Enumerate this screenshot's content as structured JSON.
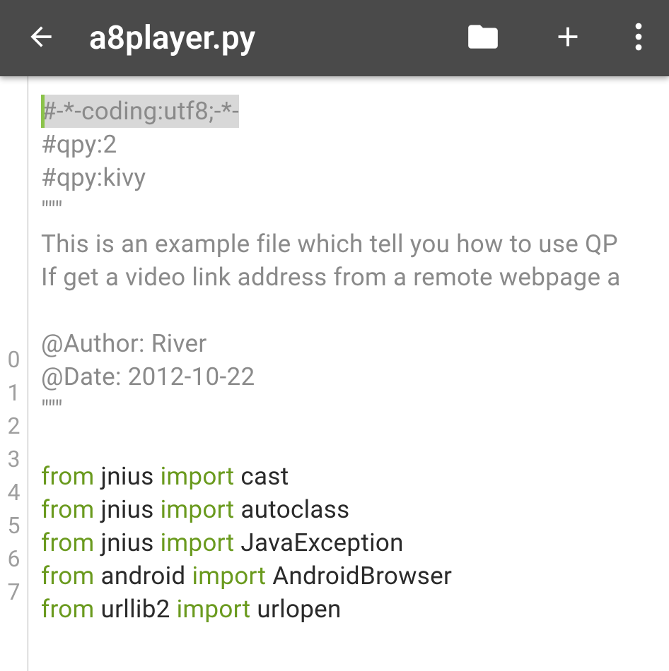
{
  "header": {
    "title": "a8player.py"
  },
  "gutter": {
    "visible_numbers": [
      "0",
      "1",
      "2",
      "3",
      "4",
      "5",
      "6",
      "7"
    ]
  },
  "code": {
    "lines": [
      {
        "type": "coding",
        "text": "#-*-coding:utf8;-*-"
      },
      {
        "type": "comment",
        "text": "#qpy:2"
      },
      {
        "type": "comment",
        "text": "#qpy:kivy"
      },
      {
        "type": "comment",
        "text": "\"\"\""
      },
      {
        "type": "comment",
        "text": "This is an example file which tell you how to use QP"
      },
      {
        "type": "comment",
        "text": "If get a video link address from a remote webpage a"
      },
      {
        "type": "comment",
        "text": ""
      },
      {
        "type": "comment",
        "text": "@Author: River"
      },
      {
        "type": "comment",
        "text": "@Date: 2012-10-22"
      },
      {
        "type": "comment",
        "text": "\"\"\""
      },
      {
        "type": "comment",
        "text": ""
      },
      {
        "type": "import",
        "kw1": "from",
        "mod": "jnius",
        "kw2": "import",
        "name": "cast"
      },
      {
        "type": "import",
        "kw1": "from",
        "mod": "jnius",
        "kw2": "import",
        "name": "autoclass"
      },
      {
        "type": "import",
        "kw1": "from",
        "mod": "jnius",
        "kw2": "import",
        "name": "JavaException"
      },
      {
        "type": "import",
        "kw1": "from",
        "mod": "android",
        "kw2": "import",
        "name": "AndroidBrowser"
      },
      {
        "type": "import",
        "kw1": "from",
        "mod": "urllib2",
        "kw2": "import",
        "name": "urlopen"
      }
    ]
  },
  "icons": {
    "back": "back-arrow",
    "folder": "folder",
    "add": "plus",
    "menu": "more-vert"
  }
}
